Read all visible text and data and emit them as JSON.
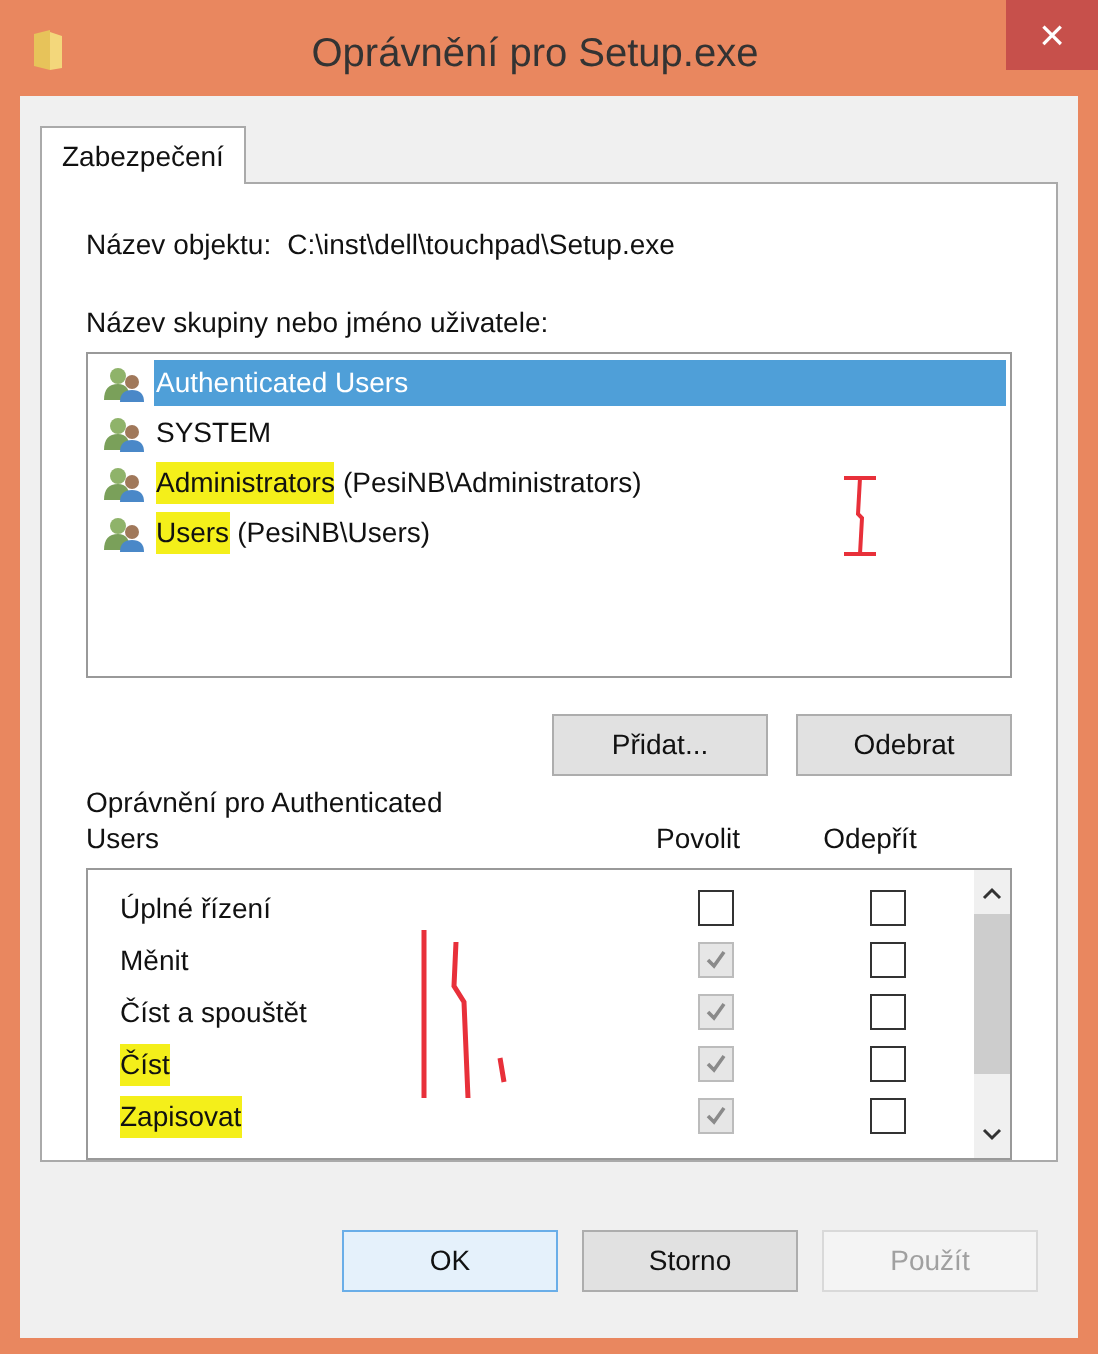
{
  "window": {
    "title": "Oprávnění pro Setup.exe",
    "close": "×"
  },
  "tabs": [
    {
      "label": "Zabezpečení",
      "selected": true
    }
  ],
  "object": {
    "label": "Název objektu:",
    "value": "C:\\inst\\dell\\touchpad\\Setup.exe"
  },
  "groups": {
    "label": "Název skupiny nebo jméno uživatele:",
    "items": [
      {
        "name": "Authenticated Users",
        "selected": true,
        "highlighted": false
      },
      {
        "name": "SYSTEM",
        "selected": false,
        "highlighted": false
      },
      {
        "name": "Administrators",
        "detail": "(PesiNB\\Administrators)",
        "selected": false,
        "highlighted": true
      },
      {
        "name": "Users",
        "detail": "(PesiNB\\Users)",
        "selected": false,
        "highlighted": true
      }
    ]
  },
  "group_buttons": [
    "Přidat...",
    "Odebrat"
  ],
  "permissions": {
    "label": "Oprávnění pro Authenticated Users",
    "columns": [
      "Povolit",
      "Odepřít"
    ],
    "rows": [
      {
        "name": "Úplné řízení",
        "allow": false,
        "deny": false,
        "highlighted": false
      },
      {
        "name": "Měnit",
        "allow": true,
        "deny": false,
        "highlighted": false
      },
      {
        "name": "Číst a spouštět",
        "allow": true,
        "deny": false,
        "highlighted": false
      },
      {
        "name": "Číst",
        "allow": true,
        "deny": false,
        "highlighted": true
      },
      {
        "name": "Zapisovat",
        "allow": true,
        "deny": false,
        "highlighted": true
      }
    ]
  },
  "buttons": [
    {
      "label": "OK",
      "disabled": false
    },
    {
      "label": "Storno",
      "disabled": false
    },
    {
      "label": "Použít",
      "disabled": true
    }
  ]
}
